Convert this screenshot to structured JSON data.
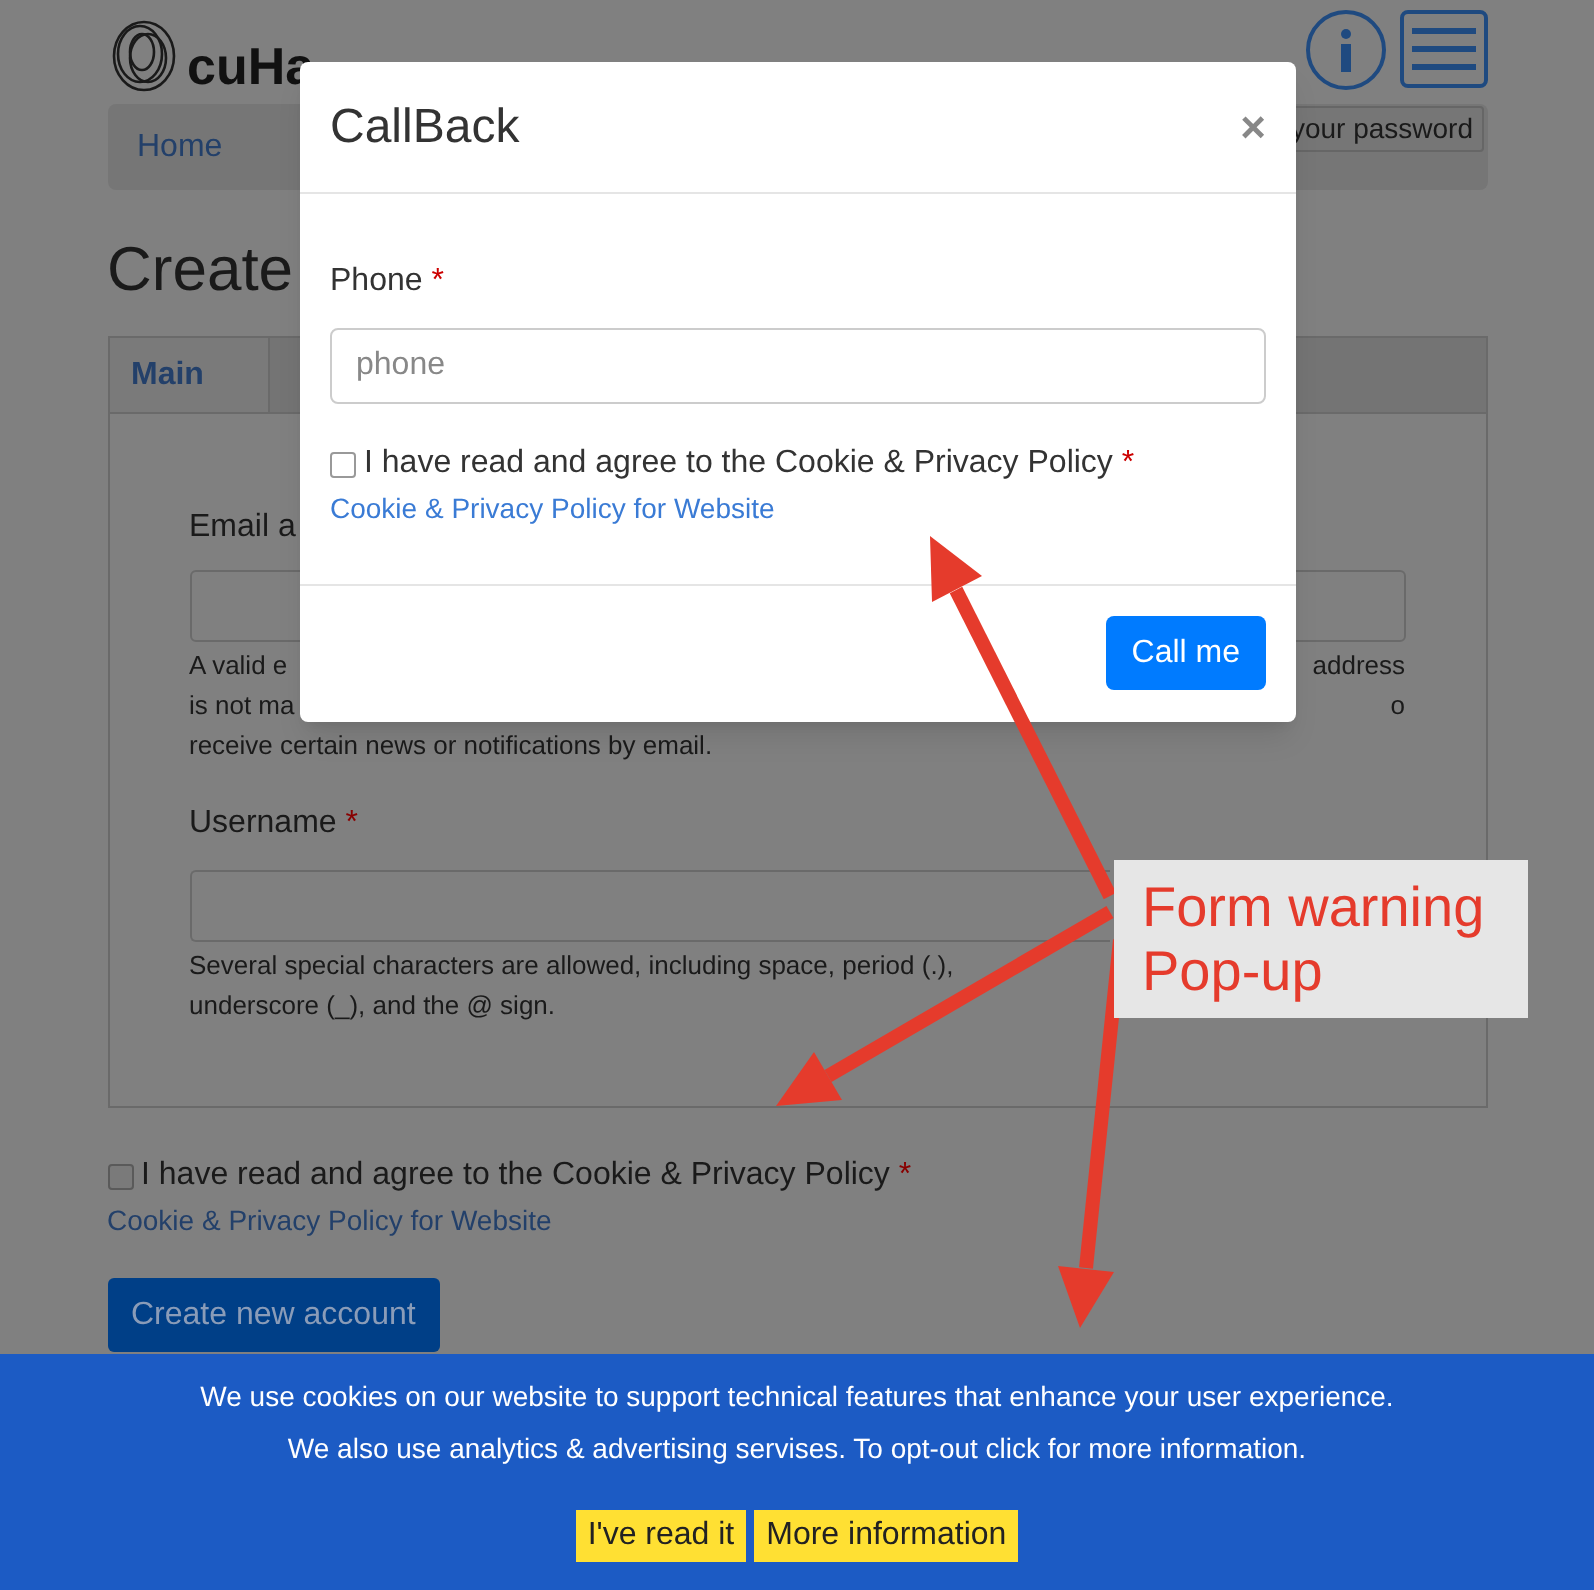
{
  "header": {
    "brand": "cuHa"
  },
  "nav": {
    "items": [
      {
        "label": "Home"
      }
    ],
    "password_button": "your password"
  },
  "page_title": "Create",
  "tabs": [
    {
      "label": "Main",
      "selected": true
    }
  ],
  "email": {
    "label": "Email a",
    "help_lines": [
      {
        "left": "A valid e",
        "right": "address"
      },
      {
        "left": "is not ma",
        "right": "o"
      },
      {
        "left": "receive certain news or notifications by email."
      }
    ]
  },
  "username": {
    "label": "Username",
    "required_mark": "*",
    "help_lines": [
      "Several special characters are allowed, including space, period (.),",
      "underscore (_), and the @ sign."
    ]
  },
  "consent": {
    "label": "I have read and agree to the Cookie & Privacy Policy",
    "required_mark": "*",
    "checked": false,
    "link": "Cookie & Privacy Policy for Website"
  },
  "submit": "Create new account",
  "modal": {
    "title": "CallBack",
    "close": "×",
    "phone_label": "Phone",
    "required_mark": "*",
    "placeholder": "phone",
    "consent": {
      "label": "I have read and agree to the Cookie & Privacy Policy",
      "required_mark": "*",
      "checked": false,
      "link": "Cookie & Privacy Policy for Website"
    },
    "button": "Call me"
  },
  "annotation": {
    "text": "Form warning Pop-up"
  },
  "cookie_banner": {
    "lines": [
      "We use cookies on our website to support technical features that enhance your user experience.",
      "We also use analytics & advertising servises. To opt-out click for more information."
    ],
    "buttons": [
      "I've read it",
      "More information"
    ]
  }
}
